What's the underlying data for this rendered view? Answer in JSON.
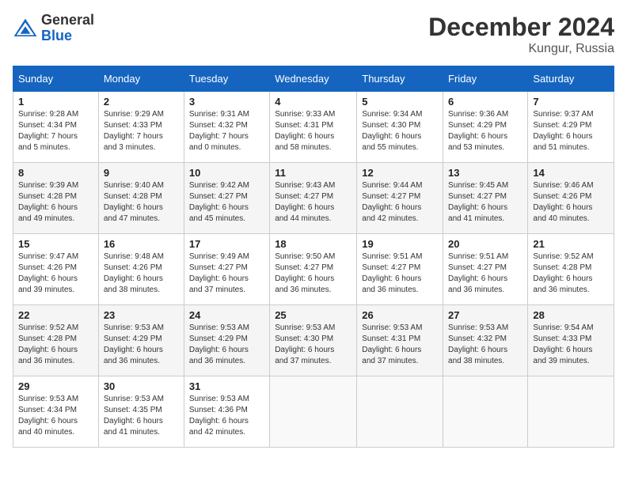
{
  "logo": {
    "general": "General",
    "blue": "Blue"
  },
  "title": "December 2024",
  "location": "Kungur, Russia",
  "days_of_week": [
    "Sunday",
    "Monday",
    "Tuesday",
    "Wednesday",
    "Thursday",
    "Friday",
    "Saturday"
  ],
  "weeks": [
    [
      {
        "day": "1",
        "sunrise": "9:28 AM",
        "sunset": "4:34 PM",
        "daylight": "7 hours and 5 minutes."
      },
      {
        "day": "2",
        "sunrise": "9:29 AM",
        "sunset": "4:33 PM",
        "daylight": "7 hours and 3 minutes."
      },
      {
        "day": "3",
        "sunrise": "9:31 AM",
        "sunset": "4:32 PM",
        "daylight": "7 hours and 0 minutes."
      },
      {
        "day": "4",
        "sunrise": "9:33 AM",
        "sunset": "4:31 PM",
        "daylight": "6 hours and 58 minutes."
      },
      {
        "day": "5",
        "sunrise": "9:34 AM",
        "sunset": "4:30 PM",
        "daylight": "6 hours and 55 minutes."
      },
      {
        "day": "6",
        "sunrise": "9:36 AM",
        "sunset": "4:29 PM",
        "daylight": "6 hours and 53 minutes."
      },
      {
        "day": "7",
        "sunrise": "9:37 AM",
        "sunset": "4:29 PM",
        "daylight": "6 hours and 51 minutes."
      }
    ],
    [
      {
        "day": "8",
        "sunrise": "9:39 AM",
        "sunset": "4:28 PM",
        "daylight": "6 hours and 49 minutes."
      },
      {
        "day": "9",
        "sunrise": "9:40 AM",
        "sunset": "4:28 PM",
        "daylight": "6 hours and 47 minutes."
      },
      {
        "day": "10",
        "sunrise": "9:42 AM",
        "sunset": "4:27 PM",
        "daylight": "6 hours and 45 minutes."
      },
      {
        "day": "11",
        "sunrise": "9:43 AM",
        "sunset": "4:27 PM",
        "daylight": "6 hours and 44 minutes."
      },
      {
        "day": "12",
        "sunrise": "9:44 AM",
        "sunset": "4:27 PM",
        "daylight": "6 hours and 42 minutes."
      },
      {
        "day": "13",
        "sunrise": "9:45 AM",
        "sunset": "4:27 PM",
        "daylight": "6 hours and 41 minutes."
      },
      {
        "day": "14",
        "sunrise": "9:46 AM",
        "sunset": "4:26 PM",
        "daylight": "6 hours and 40 minutes."
      }
    ],
    [
      {
        "day": "15",
        "sunrise": "9:47 AM",
        "sunset": "4:26 PM",
        "daylight": "6 hours and 39 minutes."
      },
      {
        "day": "16",
        "sunrise": "9:48 AM",
        "sunset": "4:26 PM",
        "daylight": "6 hours and 38 minutes."
      },
      {
        "day": "17",
        "sunrise": "9:49 AM",
        "sunset": "4:27 PM",
        "daylight": "6 hours and 37 minutes."
      },
      {
        "day": "18",
        "sunrise": "9:50 AM",
        "sunset": "4:27 PM",
        "daylight": "6 hours and 36 minutes."
      },
      {
        "day": "19",
        "sunrise": "9:51 AM",
        "sunset": "4:27 PM",
        "daylight": "6 hours and 36 minutes."
      },
      {
        "day": "20",
        "sunrise": "9:51 AM",
        "sunset": "4:27 PM",
        "daylight": "6 hours and 36 minutes."
      },
      {
        "day": "21",
        "sunrise": "9:52 AM",
        "sunset": "4:28 PM",
        "daylight": "6 hours and 36 minutes."
      }
    ],
    [
      {
        "day": "22",
        "sunrise": "9:52 AM",
        "sunset": "4:28 PM",
        "daylight": "6 hours and 36 minutes."
      },
      {
        "day": "23",
        "sunrise": "9:53 AM",
        "sunset": "4:29 PM",
        "daylight": "6 hours and 36 minutes."
      },
      {
        "day": "24",
        "sunrise": "9:53 AM",
        "sunset": "4:29 PM",
        "daylight": "6 hours and 36 minutes."
      },
      {
        "day": "25",
        "sunrise": "9:53 AM",
        "sunset": "4:30 PM",
        "daylight": "6 hours and 37 minutes."
      },
      {
        "day": "26",
        "sunrise": "9:53 AM",
        "sunset": "4:31 PM",
        "daylight": "6 hours and 37 minutes."
      },
      {
        "day": "27",
        "sunrise": "9:53 AM",
        "sunset": "4:32 PM",
        "daylight": "6 hours and 38 minutes."
      },
      {
        "day": "28",
        "sunrise": "9:54 AM",
        "sunset": "4:33 PM",
        "daylight": "6 hours and 39 minutes."
      }
    ],
    [
      {
        "day": "29",
        "sunrise": "9:53 AM",
        "sunset": "4:34 PM",
        "daylight": "6 hours and 40 minutes."
      },
      {
        "day": "30",
        "sunrise": "9:53 AM",
        "sunset": "4:35 PM",
        "daylight": "6 hours and 41 minutes."
      },
      {
        "day": "31",
        "sunrise": "9:53 AM",
        "sunset": "4:36 PM",
        "daylight": "6 hours and 42 minutes."
      },
      null,
      null,
      null,
      null
    ]
  ],
  "labels": {
    "sunrise": "Sunrise:",
    "sunset": "Sunset:",
    "daylight": "Daylight:"
  }
}
